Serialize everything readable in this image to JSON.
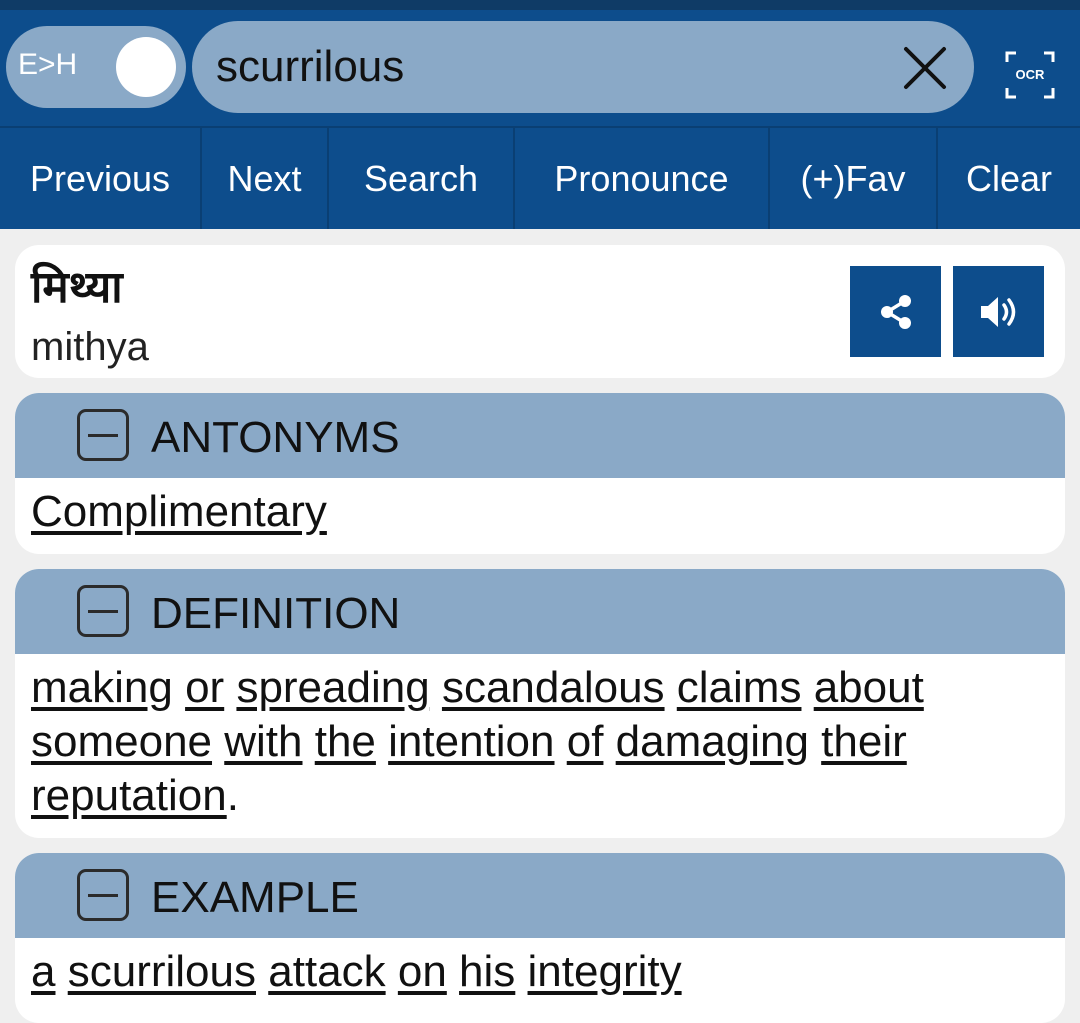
{
  "header": {
    "toggle_label": "E>H",
    "search_value": "scurrilous",
    "ocr_label": "OCR"
  },
  "nav": {
    "previous": "Previous",
    "next": "Next",
    "search": "Search",
    "pronounce": "Pronounce",
    "fav": "(+)Fav",
    "clear": "Clear"
  },
  "result": {
    "hindi": "मिथ्या",
    "transliteration": "mithya"
  },
  "sections": {
    "antonyms": {
      "title": "ANTONYMS",
      "words": [
        "Complimentary"
      ]
    },
    "definition": {
      "title": "DEFINITION",
      "words": [
        "making",
        "or",
        "spreading",
        "scandalous",
        "claims",
        "about",
        "someone",
        "with",
        "the",
        "intention",
        "of",
        "damaging",
        "their",
        "reputation"
      ],
      "trailing": "."
    },
    "example": {
      "title": "EXAMPLE",
      "words": [
        "a",
        "scurrilous",
        "attack",
        "on",
        "his",
        "integrity"
      ]
    }
  },
  "colors": {
    "primary": "#0d4d8c",
    "header_light": "#8aa9c7"
  }
}
